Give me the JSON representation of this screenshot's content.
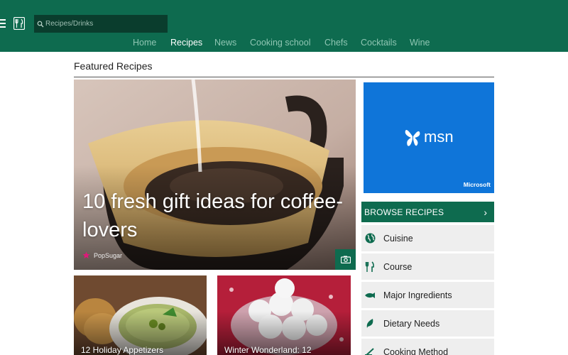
{
  "header": {
    "search_placeholder": "Recipes/Drinks",
    "nav": [
      {
        "label": "Home",
        "active": false
      },
      {
        "label": "Recipes",
        "active": true
      },
      {
        "label": "News",
        "active": false
      },
      {
        "label": "Cooking school",
        "active": false
      },
      {
        "label": "Chefs",
        "active": false
      },
      {
        "label": "Cocktails",
        "active": false
      },
      {
        "label": "Wine",
        "active": false
      }
    ]
  },
  "featured": {
    "section_title": "Featured Recipes",
    "hero_title": "10 fresh gift ideas for coffee-lovers",
    "hero_source": "PopSugar",
    "cards": [
      {
        "title": "12 Holiday Appetizers"
      },
      {
        "title": "Winter Wonderland: 12"
      }
    ]
  },
  "ad": {
    "logo_text": "msn",
    "brand": "Microsoft",
    "color": "#0f75d9"
  },
  "browse": {
    "title": "BROWSE RECIPES",
    "chevron": "›",
    "items": [
      {
        "label": "Cuisine",
        "icon": "globe-icon"
      },
      {
        "label": "Course",
        "icon": "fork-knife-icon"
      },
      {
        "label": "Major Ingredients",
        "icon": "fish-icon"
      },
      {
        "label": "Dietary Needs",
        "icon": "leaf-icon"
      },
      {
        "label": "Cooking Method",
        "icon": "pan-icon"
      }
    ]
  },
  "colors": {
    "brand_green": "#0e6b4f",
    "nav_inactive": "#8fc6b3",
    "search_bg": "#0a3d2d"
  }
}
